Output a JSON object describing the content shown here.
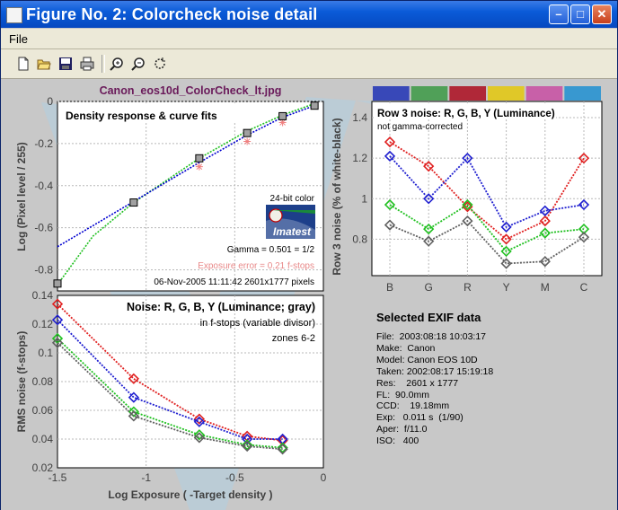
{
  "window": {
    "title": "Figure No. 2: Colorcheck noise detail"
  },
  "menu": {
    "file": "File"
  },
  "toolbar": {
    "icons": [
      "new-file-icon",
      "open-file-icon",
      "save-icon",
      "print-icon",
      "zoom-in-icon",
      "zoom-out-icon",
      "rotate-icon"
    ]
  },
  "figure_title": "Canon_eos10d_ColorCheck_lt.jpg",
  "exif": {
    "title": "Selected EXIF data",
    "lines": [
      "File:  2003:08:18 10:03:17",
      "Make:  Canon",
      "Model: Canon EOS 10D",
      "Taken: 2002:08:17 15:19:18",
      "Res:    2601 x 1777",
      "FL:  90.0mm",
      "CCD:    19.18mm",
      "Exp:   0.011 s  (1/90)",
      "Aper:  f/11.0",
      "ISO:   400"
    ]
  },
  "chart_data": [
    {
      "type": "line",
      "id": "density",
      "title": "Density response & curve fits",
      "ylabel": "Log (Pixel level / 255)",
      "xlim": [
        -1.5,
        0
      ],
      "ylim": [
        -0.9,
        0
      ],
      "yticks": [
        0,
        -0.2,
        -0.4,
        -0.6,
        -0.8
      ],
      "points": {
        "x": [
          -1.5,
          -1.07,
          -0.7,
          -0.43,
          -0.23,
          -0.05
        ],
        "y": [
          -0.865,
          -0.48,
          -0.27,
          -0.15,
          -0.07,
          -0.02
        ]
      },
      "exposure_points": {
        "x": [
          -0.7,
          -0.43,
          -0.23
        ],
        "y": [
          -0.31,
          -0.19,
          -0.1
        ]
      },
      "fit_blue": {
        "x": [
          -1.5,
          -1.07,
          -0.7,
          -0.43,
          -0.23,
          -0.05
        ],
        "y": [
          -0.69,
          -0.475,
          -0.29,
          -0.16,
          -0.075,
          -0.02
        ]
      },
      "fit_green": {
        "x": [
          -1.5,
          -1.3,
          -1.07,
          -0.7,
          -0.43,
          -0.23,
          -0.05
        ],
        "y": [
          -0.87,
          -0.64,
          -0.48,
          -0.27,
          -0.14,
          -0.065,
          -0.01
        ]
      },
      "colors": {
        "marker_fill": "#a0a0a0",
        "exposure": "#f08080",
        "fit_blue": "#0000d0",
        "fit_green": "#20c020"
      },
      "annotations": {
        "bit_color": "24-bit color",
        "logo": "Imatest",
        "gamma": "Gamma = 0.501 = 1/2",
        "exposure_error": "Exposure error = 0.21 f-stops",
        "date_pixels": "06-Nov-2005 11:11:42   2601x1777 pixels"
      }
    },
    {
      "type": "line",
      "id": "noise",
      "title": "Noise: R, G, B, Y (Luminance; gray)",
      "subtitle": "in f-stops (variable divisor)",
      "zones": "zones 6-2",
      "xlabel": "Log Exposure ( -Target density )",
      "ylabel": "RMS noise (f-stops)",
      "xlim": [
        -1.5,
        0
      ],
      "ylim": [
        0.02,
        0.14
      ],
      "xticks": [
        -1.5,
        -1,
        -0.5,
        0
      ],
      "yticks": [
        0.02,
        0.04,
        0.06,
        0.08,
        0.1,
        0.12,
        0.14
      ],
      "x": [
        -1.5,
        -1.07,
        -0.7,
        -0.43,
        -0.23
      ],
      "series": [
        {
          "color": "#e02020",
          "values": [
            0.134,
            0.082,
            0.054,
            0.042,
            0.039
          ]
        },
        {
          "color": "#2020d0",
          "values": [
            0.123,
            0.069,
            0.052,
            0.04,
            0.04
          ]
        },
        {
          "color": "#20c020",
          "values": [
            0.11,
            0.059,
            0.043,
            0.036,
            0.034
          ]
        },
        {
          "color": "#606060",
          "values": [
            0.107,
            0.056,
            0.041,
            0.035,
            0.033
          ]
        }
      ]
    },
    {
      "type": "line",
      "id": "row3",
      "title": "Row 3 noise: R, G, B, Y (Luminance)",
      "subtitle": "not gamma-corrected",
      "ylabel": "Row 3 noise (% of white-black)",
      "categories": [
        "B",
        "G",
        "R",
        "Y",
        "M",
        "C"
      ],
      "ylim": [
        0.62,
        1.48
      ],
      "yticks": [
        0.8,
        1,
        1.2,
        1.4
      ],
      "patch_colors": [
        "#3848b8",
        "#50a058",
        "#b02838",
        "#e0c828",
        "#c860a8",
        "#3898d0"
      ],
      "series": [
        {
          "color": "#e02020",
          "values": [
            1.28,
            1.16,
            0.96,
            0.8,
            0.89,
            1.2
          ]
        },
        {
          "color": "#2020d0",
          "values": [
            1.21,
            1.0,
            1.2,
            0.86,
            0.94,
            0.97
          ]
        },
        {
          "color": "#20c020",
          "values": [
            0.97,
            0.85,
            0.97,
            0.74,
            0.83,
            0.85
          ]
        },
        {
          "color": "#606060",
          "values": [
            0.87,
            0.79,
            0.89,
            0.68,
            0.69,
            0.81
          ]
        }
      ]
    }
  ]
}
